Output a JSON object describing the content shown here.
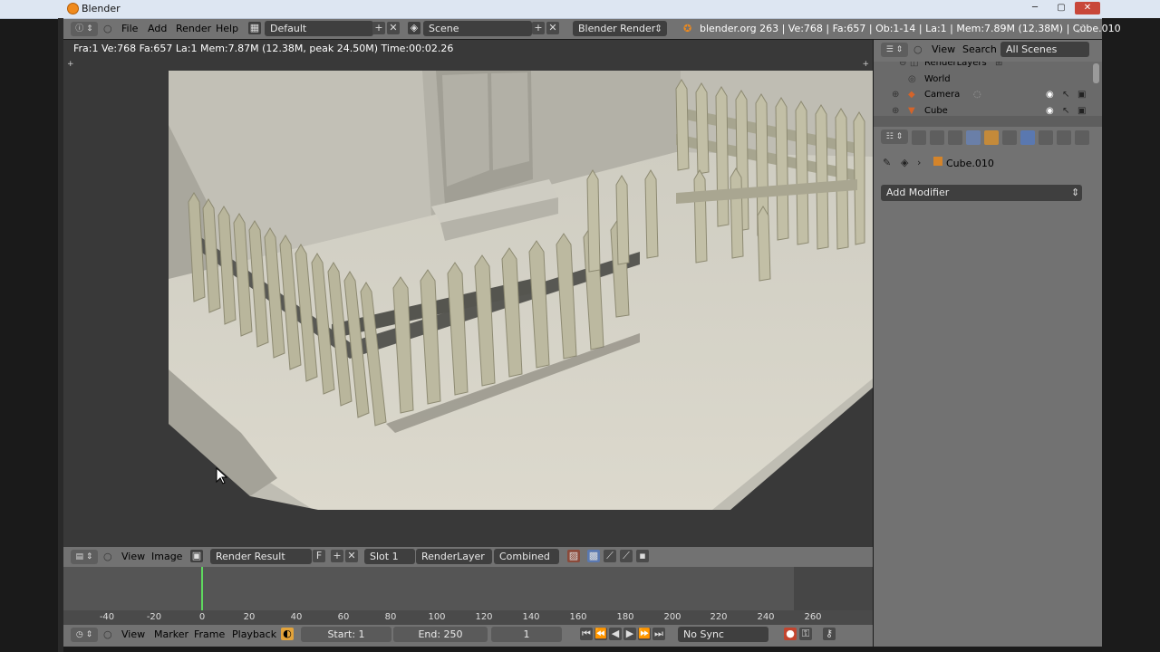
{
  "window": {
    "title": "Blender",
    "btn_min": "─",
    "btn_max": "▢",
    "btn_close": "✕"
  },
  "info": {
    "menus": [
      "File",
      "Add",
      "Render",
      "Help"
    ],
    "screen_layout": "Default",
    "scene": "Scene",
    "engine": "Blender Render",
    "stats": "blender.org 263 | Ve:768 | Fa:657 | Ob:1-14 | La:1 | Mem:7.89M (12.38M) | Cube.010"
  },
  "viewport": {
    "render_stats": "Fra:1  Ve:768 Fa:657 La:1 Mem:7.87M (12.38M, peak 24.50M) Time:00:02.26"
  },
  "image_editor": {
    "view": "View",
    "image": "Image",
    "image_name": "Render Result",
    "fake_user": "F",
    "slot": "Slot 1",
    "layer": "RenderLayer",
    "pass": "Combined"
  },
  "timeline": {
    "ticks": [
      "-40",
      "-20",
      "0",
      "20",
      "40",
      "60",
      "80",
      "100",
      "120",
      "140",
      "160",
      "180",
      "200",
      "220",
      "240",
      "260"
    ],
    "menus": [
      "View",
      "Marker",
      "Frame",
      "Playback"
    ],
    "start": "Start: 1",
    "end": "End: 250",
    "current": "1",
    "sync": "No Sync"
  },
  "outliner": {
    "view": "View",
    "search": "Search",
    "filter": "All Scenes",
    "items": [
      "RenderLayers",
      "World",
      "Camera",
      "Cube"
    ]
  },
  "properties": {
    "object": "Cube.010",
    "add_modifier": "Add Modifier"
  }
}
